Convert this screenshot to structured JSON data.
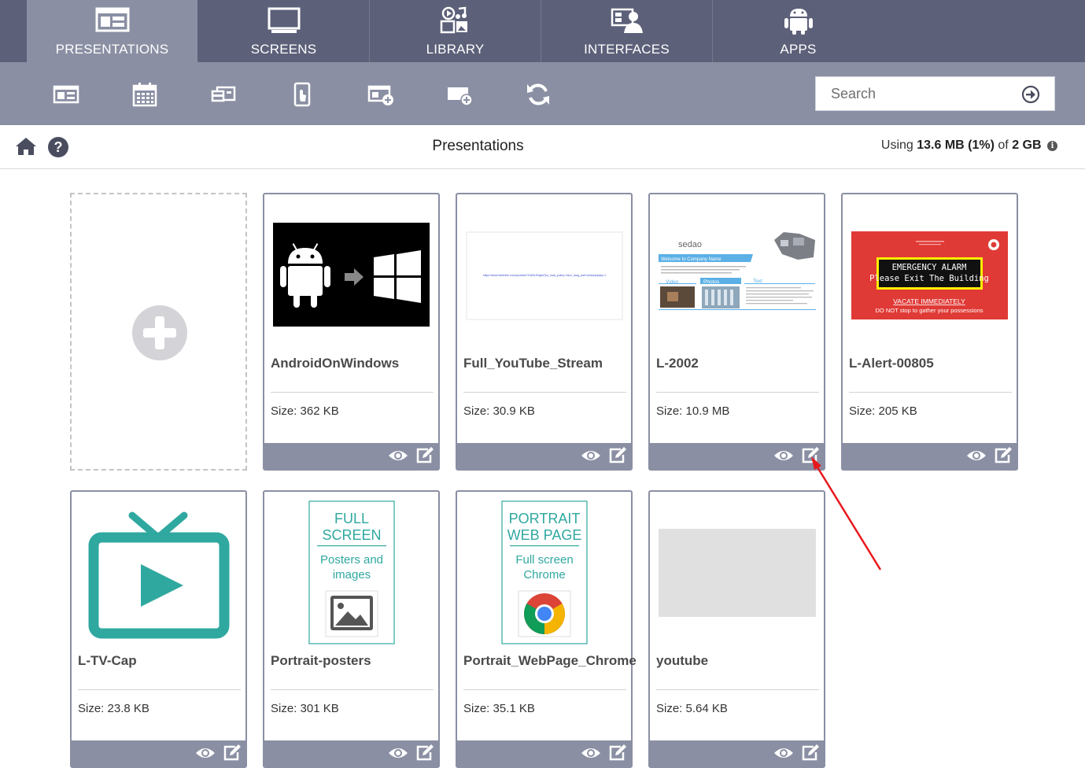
{
  "nav": {
    "tabs": [
      {
        "label": "PRESENTATIONS",
        "icon": "presentations-icon",
        "active": true
      },
      {
        "label": "SCREENS",
        "icon": "monitor-icon",
        "active": false
      },
      {
        "label": "LIBRARY",
        "icon": "media-library-icon",
        "active": false
      },
      {
        "label": "INTERFACES",
        "icon": "interface-user-icon",
        "active": false
      },
      {
        "label": "APPS",
        "icon": "android-icon",
        "active": false
      }
    ]
  },
  "toolbar": {
    "tools": [
      "presentation-layout-icon",
      "calendar-icon",
      "playlist-icon",
      "touch-device-icon",
      "add-presentation-icon",
      "add-zone-icon",
      "refresh-icon"
    ]
  },
  "search": {
    "placeholder": "Search",
    "value": ""
  },
  "header": {
    "title": "Presentations",
    "usage_prefix": "Using",
    "usage_used": "13.6 MB (1%)",
    "usage_of": "of",
    "usage_total": "2 GB"
  },
  "cards": [
    {
      "name": "AndroidOnWindows",
      "size": "Size: 362 KB"
    },
    {
      "name": "Full_YouTube_Stream",
      "size": "Size: 30.9 KB"
    },
    {
      "name": "L-2002",
      "size": "Size: 10.9 MB"
    },
    {
      "name": "L-Alert-00805",
      "size": "Size: 205 KB"
    },
    {
      "name": "L-TV-Cap",
      "size": "Size: 23.8 KB"
    },
    {
      "name": "Portrait-posters",
      "size": "Size: 301 KB"
    },
    {
      "name": "Portrait_WebPage_Chrome",
      "size": "Size: 35.1 KB"
    },
    {
      "name": "youtube",
      "size": "Size: 5.64 KB"
    }
  ],
  "thumbs": {
    "youtube_url": "https://www.silverline.com/youtube?CMNLK0gdsTyu_load_policy=1&cc_lang_pref=en&autoplay=1",
    "l2002_logo": "sedao",
    "l2002_welcome": "Welcome to Company Name",
    "l2002_video": "Video",
    "l2002_photos": "Photos",
    "l2002_text": "Text",
    "alert_title": "EMERGENCY ALARM",
    "alert_sub": "Please Exit The Building",
    "alert_vacate": "VACATE IMMEDIATELY",
    "alert_note": "DO NOT stop to gather your possessions",
    "poster_title1": "FULL",
    "poster_title2": "SCREEN",
    "poster_sub1": "Posters and",
    "poster_sub2": "images",
    "web_title1": "PORTRAIT",
    "web_title2": "WEB PAGE",
    "web_sub1": "Full screen",
    "web_sub2": "Chrome"
  },
  "colors": {
    "nav_bg": "#5c6079",
    "nav_active": "#8a8fa3",
    "teal": "#2fa8a0",
    "alert_red": "#e03a36",
    "annotation_arrow": "#e8191d"
  }
}
